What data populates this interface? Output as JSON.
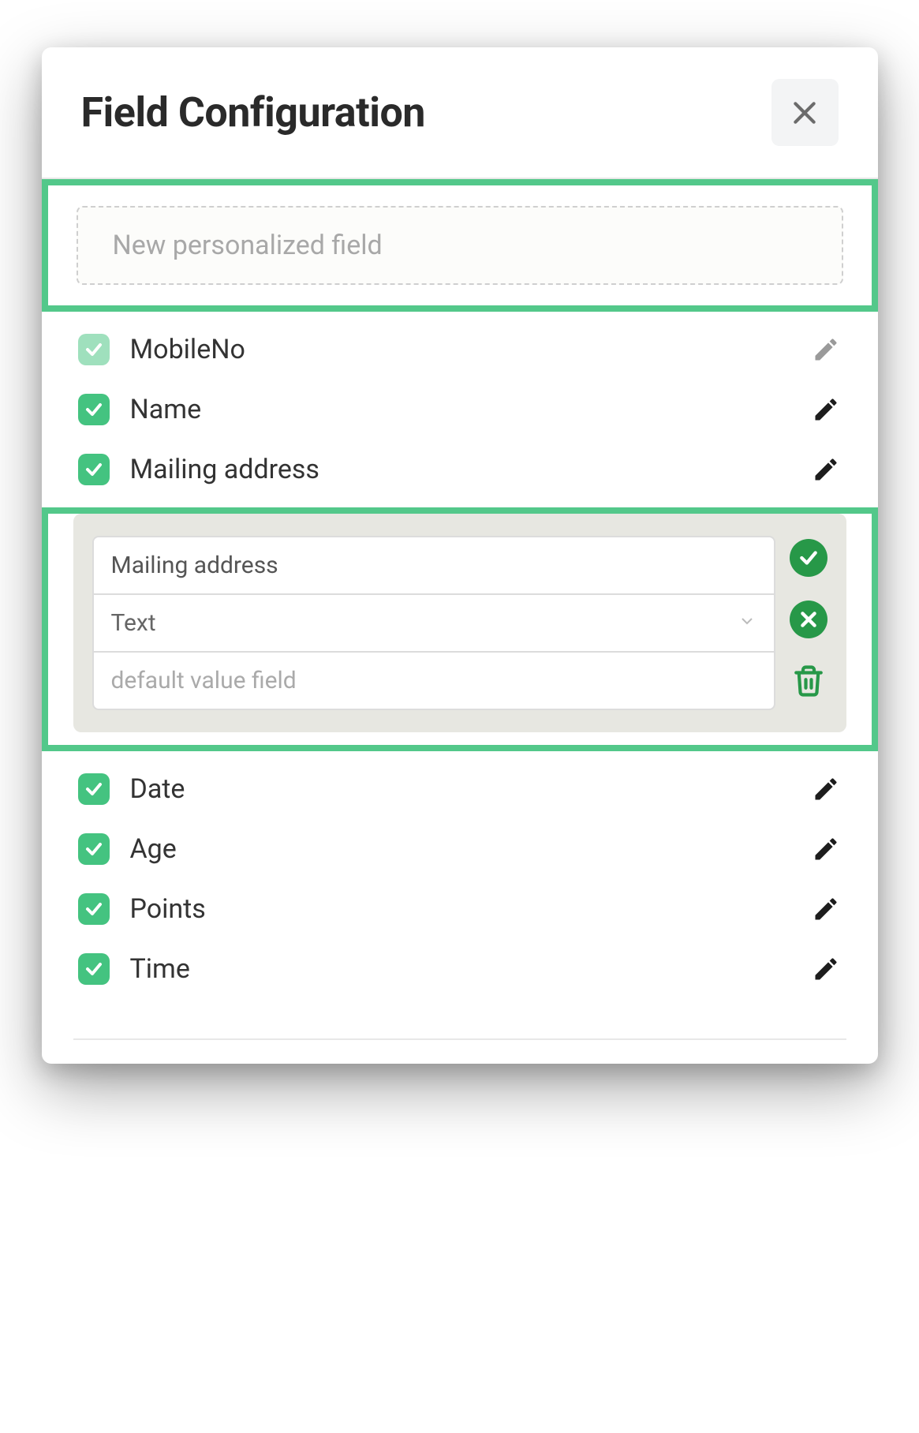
{
  "colors": {
    "accent": "#44c380",
    "accentDark": "#279848",
    "highlightBorder": "#53c88a"
  },
  "header": {
    "title": "Field Configuration"
  },
  "newField": {
    "placeholder": "New personalized field"
  },
  "fields": {
    "top": [
      {
        "label": "MobileNo",
        "checked": true,
        "faded": true,
        "editDisabled": true
      },
      {
        "label": "Name",
        "checked": true,
        "faded": false,
        "editDisabled": false
      },
      {
        "label": "Mailing address",
        "checked": true,
        "faded": false,
        "editDisabled": false
      }
    ],
    "bottom": [
      {
        "label": "Date",
        "checked": true
      },
      {
        "label": "Age",
        "checked": true
      },
      {
        "label": "Points",
        "checked": true
      },
      {
        "label": "Time",
        "checked": true
      }
    ]
  },
  "editPanel": {
    "nameValue": "Mailing address",
    "typeValue": "Text",
    "defaultPlaceholder": "default value field"
  }
}
